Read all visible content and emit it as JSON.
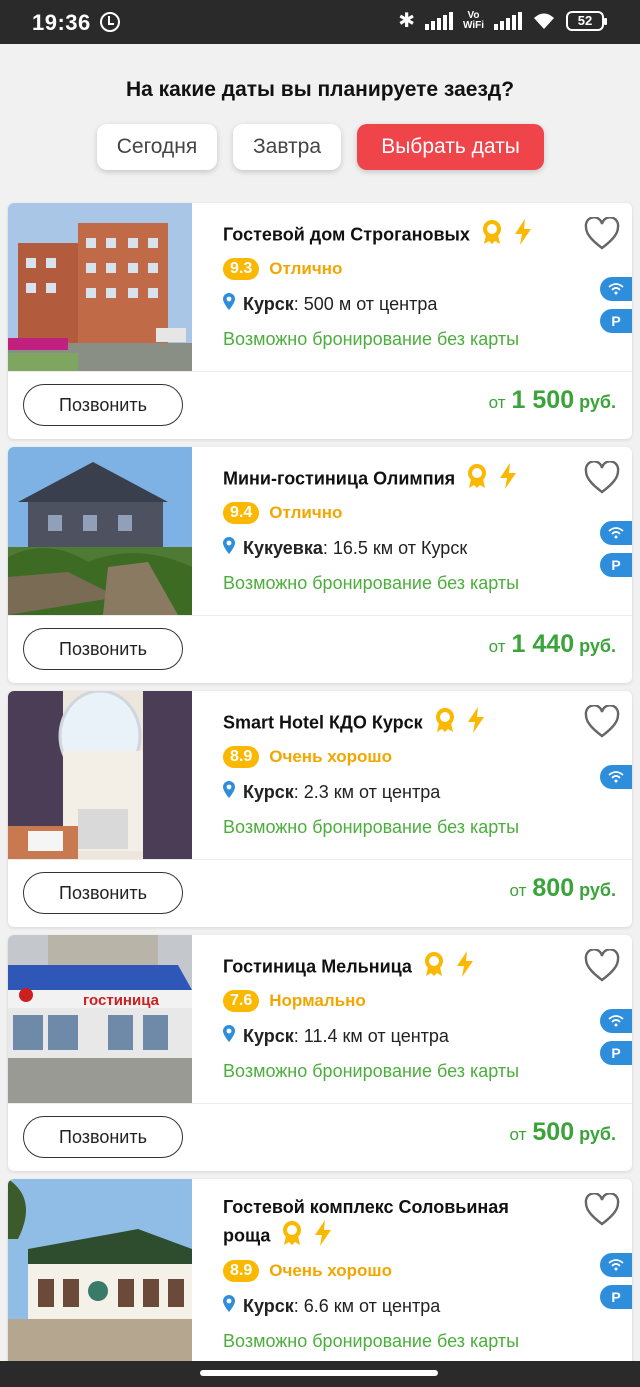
{
  "status_bar": {
    "time": "19:36",
    "battery": "52",
    "vowifi_top": "Vo",
    "vowifi_bottom": "WiFi"
  },
  "date_picker": {
    "question": "На какие даты вы планируете заезд?",
    "today": "Сегодня",
    "tomorrow": "Завтра",
    "choose": "Выбрать даты",
    "accent_color": "#f0444b"
  },
  "colors": {
    "score_bg": "#fbb800",
    "rating_text": "#f2a600",
    "green": "#4cae3c",
    "amenity_blue": "#2f8edb"
  },
  "hotels": [
    {
      "name": "Гостевой дом Строгановых",
      "score": "9.3",
      "rating_label": "Отлично",
      "city": "Курск",
      "distance": ": 500 м от центра",
      "no_card": "Возможно бронирование без карты",
      "call": "Позвонить",
      "price_from": "от",
      "price": "1 500",
      "currency": "руб.",
      "amenities": [
        "wifi-icon",
        "parking-icon"
      ]
    },
    {
      "name": "Мини-гостиница Олимпия",
      "score": "9.4",
      "rating_label": "Отлично",
      "city": "Кукуевка",
      "distance": ": 16.5 км от Курск",
      "no_card": "Возможно бронирование без карты",
      "call": "Позвонить",
      "price_from": "от",
      "price": "1 440",
      "currency": "руб.",
      "amenities": [
        "wifi-icon",
        "parking-icon"
      ]
    },
    {
      "name": "Smart Hotel КДО Курск",
      "score": "8.9",
      "rating_label": "Очень хорошо",
      "city": "Курск",
      "distance": ": 2.3 км от центра",
      "no_card": "Возможно бронирование без карты",
      "call": "Позвонить",
      "price_from": "от",
      "price": "800",
      "currency": "руб.",
      "amenities": [
        "wifi-icon"
      ]
    },
    {
      "name": "Гостиница Мельница",
      "score": "7.6",
      "rating_label": "Нормально",
      "city": "Курск",
      "distance": ": 11.4 км от центра",
      "no_card": "Возможно бронирование без карты",
      "call": "Позвонить",
      "price_from": "от",
      "price": "500",
      "currency": "руб.",
      "photo_sign": "гостиница",
      "amenities": [
        "wifi-icon",
        "parking-icon"
      ]
    },
    {
      "name_line1": "Гостевой комплекс Соловьиная",
      "name_line2": "роща",
      "score": "8.9",
      "rating_label": "Очень хорошо",
      "city": "Курск",
      "distance": ": 6.6 км от центра",
      "no_card": "Возможно бронирование без карты",
      "amenities": [
        "wifi-icon",
        "parking-icon"
      ]
    }
  ]
}
